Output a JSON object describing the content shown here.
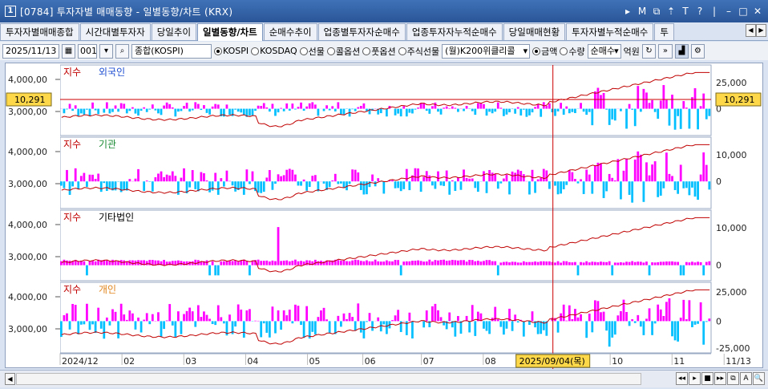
{
  "window": {
    "number": "1",
    "title": "[0784] 투자자별 매매동향 - 일별동향/차트 (KRX)",
    "controls": [
      "▸",
      "M",
      "⧉",
      "⇡",
      "T",
      "?",
      "|",
      "–",
      "□",
      "✕"
    ]
  },
  "tabs": [
    {
      "label": "투자자별매매종합",
      "active": false
    },
    {
      "label": "시간대별투자자",
      "active": false
    },
    {
      "label": "당일추이",
      "active": false
    },
    {
      "label": "일별동향/차트",
      "active": true
    },
    {
      "label": "순매수추이",
      "active": false
    },
    {
      "label": "업종별투자자순매수",
      "active": false
    },
    {
      "label": "업종투자자누적순매수",
      "active": false
    },
    {
      "label": "당일매매현황",
      "active": false
    },
    {
      "label": "투자자별누적순매수",
      "active": false
    },
    {
      "label": "투",
      "active": false
    }
  ],
  "toolbar": {
    "date": "2025/11/13",
    "code": "001",
    "market_name": "종합(KOSPI)",
    "radios": [
      {
        "label": "KOSPI",
        "on": true
      },
      {
        "label": "KOSDAQ",
        "on": false
      },
      {
        "label": "선물",
        "on": false
      },
      {
        "label": "콜옵션",
        "on": false
      },
      {
        "label": "풋옵션",
        "on": false
      },
      {
        "label": "주식선물",
        "on": false
      }
    ],
    "product": "(월)K200위클리콜",
    "unit_radios": [
      {
        "label": "금액",
        "on": true
      },
      {
        "label": "수량",
        "on": false
      }
    ],
    "mode": "순매수",
    "unit": "억원"
  },
  "crosshair": {
    "value_label": "10,291",
    "date_label": "2025/09/04(목)"
  },
  "panels": [
    {
      "name": "foreign",
      "legend_index": "지수",
      "legend_series": "외국인",
      "series_color": "#1f4fd1",
      "left_ticks": [
        "4,000,00",
        "3,000,00"
      ],
      "right_ticks": [
        "25,000",
        "0"
      ]
    },
    {
      "name": "institution",
      "legend_index": "지수",
      "legend_series": "기관",
      "series_color": "#1a8a33",
      "left_ticks": [
        "4,000,00",
        "3,000,00"
      ],
      "right_ticks": [
        "10,000",
        "0"
      ]
    },
    {
      "name": "other-corp",
      "legend_index": "지수",
      "legend_series": "기타법인",
      "series_color": "#000000",
      "left_ticks": [
        "4,000,00",
        "3,000,00"
      ],
      "right_ticks": [
        "10,000",
        "0"
      ]
    },
    {
      "name": "individual",
      "legend_index": "지수",
      "legend_series": "개인",
      "series_color": "#e0851c",
      "left_ticks": [
        "4,000,00",
        "3,000,00"
      ],
      "right_ticks": [
        "25,000",
        "0",
        "-25,000"
      ]
    }
  ],
  "x_axis_labels": [
    "2024/12",
    "02",
    "03",
    "04",
    "05",
    "06",
    "07",
    "08",
    "09",
    "10",
    "11",
    "11/13"
  ],
  "colors": {
    "positive": "#ff00ff",
    "negative": "#00bfff",
    "index_line": "#c00000",
    "crosshair": "#cc0000",
    "highlight": "#ffd84a"
  },
  "chart_data": {
    "type": "bar",
    "x_range": [
      "2024/12",
      "2025/11/13"
    ],
    "series": [
      {
        "name": "지수",
        "type": "line",
        "approx_shape": "flat near 2,500 from 2024/12 to 04, dip in 04, rising to ~3,200 by 07-08, climbing to ~4,100 by 11"
      },
      {
        "name": "외국인",
        "type": "bar",
        "approx_range": [
          -15000,
          25000
        ]
      },
      {
        "name": "기관",
        "type": "bar",
        "approx_range": [
          -8000,
          15000
        ]
      },
      {
        "name": "기타법인",
        "type": "bar",
        "approx_range": [
          -2000,
          12000
        ]
      },
      {
        "name": "개인",
        "type": "bar",
        "approx_range": [
          -25000,
          25000
        ]
      }
    ]
  },
  "bottom_nav": [
    "◂◂",
    "▸",
    "■",
    "▸▸",
    "⧉",
    "A",
    "🔍"
  ]
}
